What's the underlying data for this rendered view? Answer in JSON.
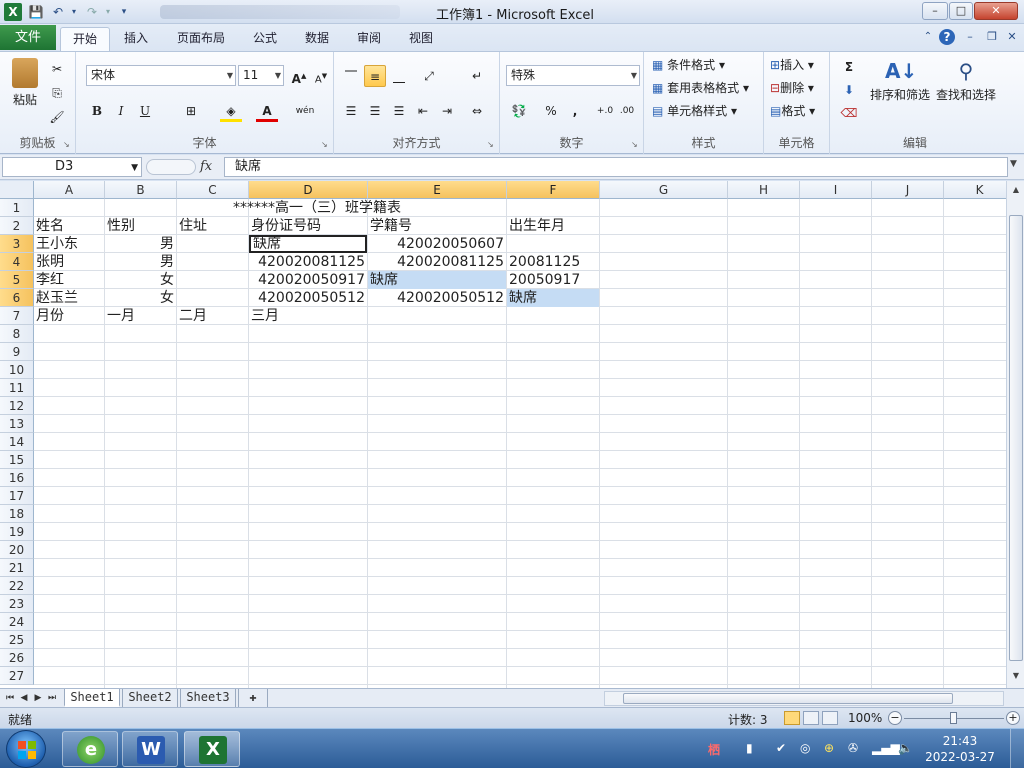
{
  "window": {
    "title": "工作簿1 - Microsoft Excel",
    "app_icon": "X",
    "quick_access": [
      "save-icon",
      "undo-icon",
      "redo-icon",
      "customize-icon"
    ],
    "min_label": "–",
    "max_label": "□",
    "close_label": "✕"
  },
  "ribbon_tabs": {
    "file": "文件",
    "tabs": [
      "开始",
      "插入",
      "页面布局",
      "公式",
      "数据",
      "审阅",
      "视图"
    ],
    "active": "开始"
  },
  "ribbon": {
    "clipboard": {
      "paste": "粘贴",
      "label": "剪贴板"
    },
    "font": {
      "name": "宋体",
      "size": "11",
      "label": "字体",
      "bold": "B",
      "italic": "I",
      "underline": "U",
      "font_color_letter": "A",
      "phonetic": "wén"
    },
    "alignment": {
      "label": "对齐方式"
    },
    "number": {
      "format": "特殊",
      "label": "数字",
      "percent": "%",
      "comma": ","
    },
    "styles": {
      "conditional": "条件格式",
      "table": "套用表格格式",
      "cell_styles": "单元格样式",
      "label": "样式"
    },
    "cells": {
      "insert": "插入",
      "delete": "删除",
      "format": "格式",
      "label": "单元格"
    },
    "editing": {
      "sum": "Σ",
      "sort": "排序和筛选",
      "find": "查找和选择",
      "label": "编辑"
    }
  },
  "formula_bar": {
    "name_box": "D3",
    "fx": "fx",
    "content": "缺席"
  },
  "sheet": {
    "columns": [
      "A",
      "B",
      "C",
      "D",
      "E",
      "F",
      "G",
      "H",
      "I",
      "J",
      "K"
    ],
    "selected_columns": [
      "D",
      "E",
      "F"
    ],
    "rows": [
      "1",
      "2",
      "3",
      "4",
      "5",
      "6",
      "7",
      "8",
      "9",
      "10",
      "11",
      "12",
      "13",
      "14",
      "15",
      "16",
      "17",
      "18",
      "19",
      "20",
      "21",
      "22",
      "23",
      "24",
      "25",
      "26",
      "27"
    ],
    "selected_rows": [
      "3",
      "4",
      "5",
      "6"
    ],
    "active_cell": "D3",
    "title": "******高一（三）班学籍表",
    "header": {
      "A": "姓名",
      "B": "性别",
      "C": "住址",
      "D": "身份证号码",
      "E": "学籍号",
      "F": "出生年月"
    },
    "data_rows": [
      {
        "A": "王小东",
        "B": "男",
        "C": "",
        "D": "缺席",
        "E": "420020050607",
        "F": ""
      },
      {
        "A": "张明",
        "B": "男",
        "C": "",
        "D": "420020081125",
        "E": "420020081125",
        "F": "20081125"
      },
      {
        "A": "李红",
        "B": "女",
        "C": "",
        "D": "420020050917",
        "E": "缺席",
        "F": "20050917"
      },
      {
        "A": "赵玉兰",
        "B": "女",
        "C": "",
        "D": "420020050512",
        "E": "420020050512",
        "F": "缺席"
      }
    ],
    "row7": {
      "A": "月份",
      "B": "一月",
      "C": "二月",
      "D": "三月"
    }
  },
  "sheet_tabs": [
    "Sheet1",
    "Sheet2",
    "Sheet3"
  ],
  "active_sheet": "Sheet1",
  "status_bar": {
    "mode": "就绪",
    "count": "计数: 3",
    "zoom": "100%"
  },
  "taskbar": {
    "apps": [
      "ie-icon",
      "word-icon",
      "excel-icon"
    ],
    "word_letter": "W",
    "excel_letter": "X",
    "time": "21:43",
    "date": "2022-03-27"
  },
  "colors": {
    "accent_green": "#1e7433",
    "selection_highlight": "#c5dcf4",
    "header_selected": "#f5c25e"
  }
}
